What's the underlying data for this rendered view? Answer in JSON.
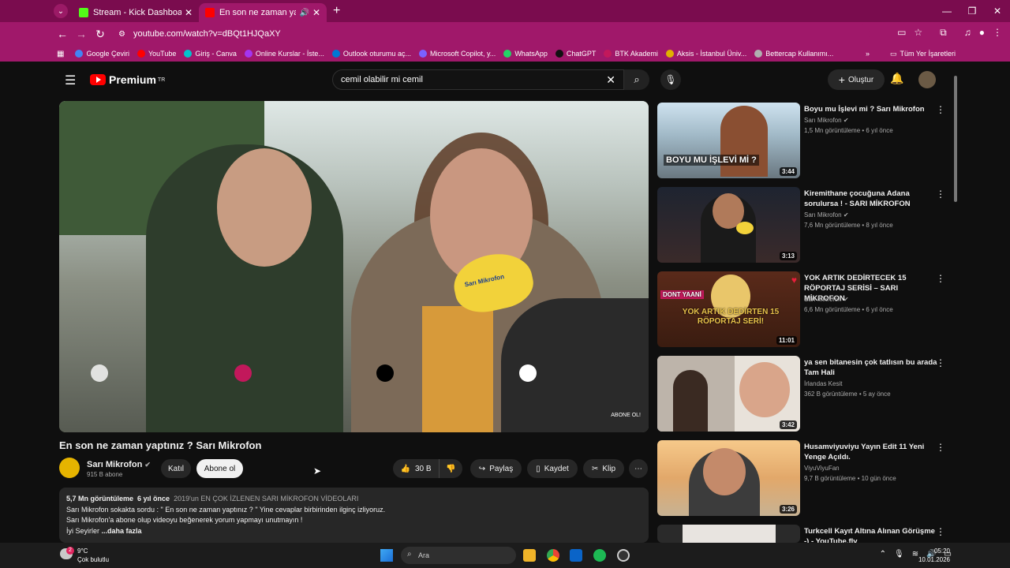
{
  "browser": {
    "tabs": [
      {
        "title": "Stream - Kick Dashboard",
        "active": false,
        "favicon_color": "#53fc18"
      },
      {
        "title": "En son ne zaman yaptınız ? Sarı Mikrofon",
        "active": true,
        "favicon_color": "#ff0000"
      }
    ],
    "url": "youtube.com/watch?v=dBQt1HJQaXY",
    "bookmarks": [
      {
        "label": "Google Çeviri",
        "color": "#4285f4"
      },
      {
        "label": "YouTube",
        "color": "#ff0000"
      },
      {
        "label": "Giriş - Canva",
        "color": "#00c4cc"
      },
      {
        "label": "Online Kurslar - İste...",
        "color": "#a435f0"
      },
      {
        "label": "Outlook oturumu aç...",
        "color": "#0078d4"
      },
      {
        "label": "Microsoft Copilot, y...",
        "color": "#7b61ff"
      },
      {
        "label": "WhatsApp",
        "color": "#25d366"
      },
      {
        "label": "ChatGPT",
        "color": "#111111"
      },
      {
        "label": "BTK Akademi",
        "color": "#c2185b"
      },
      {
        "label": "Aksis - İstanbul Üniv...",
        "color": "#e0b000"
      },
      {
        "label": "Bettercap Kullanımı...",
        "color": "#b0b0b0"
      }
    ],
    "all_bookmarks": "Tüm Yer İşaretleri"
  },
  "header": {
    "logo": "Premium",
    "region": "TR",
    "search_value": "cemil olabilir mi cemil",
    "create_label": "Oluştur"
  },
  "video": {
    "title": "En son ne zaman yaptınız ? Sarı Mikrofon",
    "channel": "Sarı Mikrofon",
    "subscribers": "915 B abone",
    "join_label": "Katıl",
    "subscribe_label": "Abone ol",
    "likes": "30 B",
    "share_label": "Paylaş",
    "save_label": "Kaydet",
    "clip_label": "Klip",
    "overlay_text": "ABONE OL!",
    "mic_text": "Sarı Mikrofon"
  },
  "description": {
    "views": "5,7 Mn görüntüleme",
    "age": "6 yıl önce",
    "hashtag": "2019'un EN ÇOK İZLENEN SARI MİKROFON VİDEOLARI",
    "line1": "Sarı Mikrofon sokakta sordu : \" En son ne zaman yaptınız ? \" Yine cevaplar birbirinden ilginç izliyoruz.",
    "line2": "Sarı Mikrofon'a abone olup videoyu beğenerek yorum yapmayı unutmayın !",
    "line3_prefix": "İyi Seyirler",
    "more": "...daha fazla"
  },
  "recommendations": [
    {
      "title": "Boyu mu İşlevi mi ? Sarı Mikrofon",
      "channel": "Sarı Mikrofon",
      "verified": true,
      "meta": "1,5 Mn görüntüleme • 6 yıl önce",
      "duration": "3:44",
      "thumb_text": "BOYU MU İŞLEVİ Mİ ?"
    },
    {
      "title": "Kiremithane çocuğuna Adana sorulursa ! - SARI MİKROFON",
      "channel": "Sarı Mikrofon",
      "verified": true,
      "meta": "7,6 Mn görüntüleme • 8 yıl önce",
      "duration": "3:13",
      "thumb_text": ""
    },
    {
      "title": "YOK ARTIK DEDİRTECEK 15 RÖPORTAJ SERİSİ – SARI MİKROFON",
      "channel": "Sarı Mikrofon",
      "verified": true,
      "meta": "6,6 Mn görüntüleme • 6 yıl önce",
      "duration": "11:01",
      "thumb_text": "YOK ARTIK DEDİRTEN 15 RÖPORTAJ SERİ!",
      "thumb_badge": "DONT YAANİ"
    },
    {
      "title": "ya sen bitanesin çok tatlısın bu arada Tam Hali",
      "channel": "İrlandas Kesit",
      "verified": false,
      "meta": "362 B görüntüleme • 5 ay önce",
      "duration": "3:42",
      "thumb_text": ""
    },
    {
      "title": "Husamviyuviyu Yayın Edit 11 Yeni Yenge Açıldı.",
      "channel": "ViyuViyuFan",
      "verified": false,
      "meta": "9,7 B görüntüleme • 10 gün önce",
      "duration": "3:26",
      "thumb_text": ""
    },
    {
      "title": "Turkcell Kayıt Altına Alınan Görüşme -) - YouTube.flv",
      "channel": "",
      "verified": false,
      "meta": "",
      "duration": "",
      "thumb_text": ""
    }
  ],
  "taskbar": {
    "temperature": "9°C",
    "weather": "Çok bulutlu",
    "weather_badge": "2",
    "search_placeholder": "Ara",
    "time": "05:20",
    "date": "10.01.2026"
  },
  "colors": {
    "chrome_frame": "#a0186a",
    "tab_strip": "#7a0c4e",
    "yt_red": "#ff0000",
    "page_bg": "#0f0f0f"
  }
}
